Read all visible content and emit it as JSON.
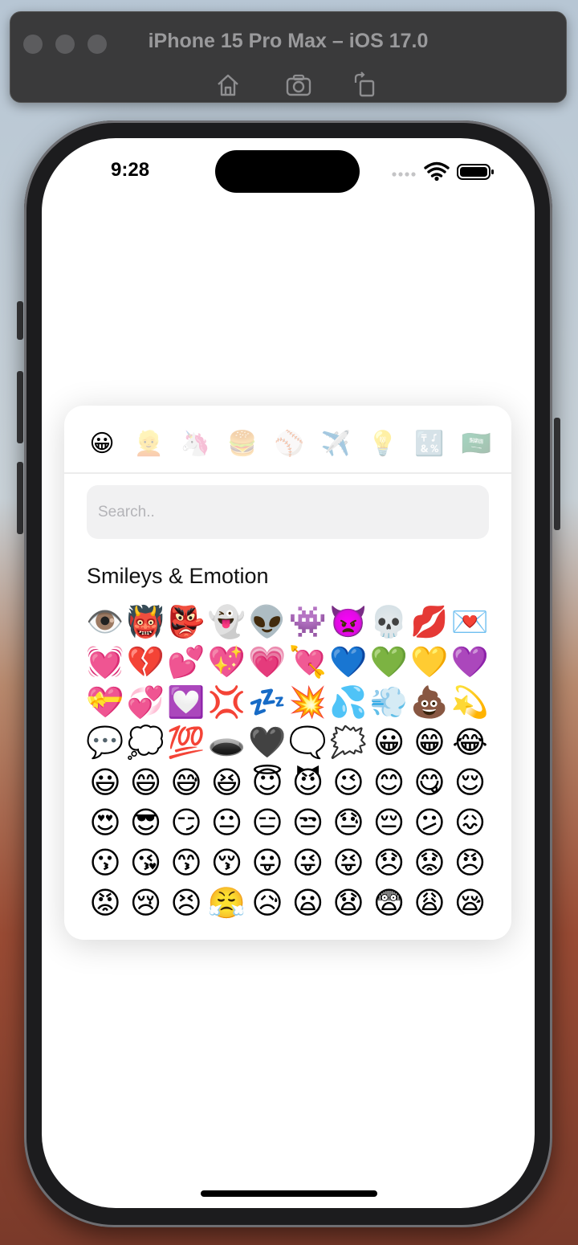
{
  "simulator": {
    "title": "iPhone 15 Pro Max – iOS 17.0",
    "icons": [
      "home-icon",
      "screenshot-icon",
      "rotate-icon"
    ]
  },
  "status_bar": {
    "time": "9:28"
  },
  "categories": [
    {
      "name": "smileys",
      "emoji": "😀",
      "active": true
    },
    {
      "name": "people",
      "emoji": "👱",
      "active": false
    },
    {
      "name": "animals",
      "emoji": "🦄",
      "active": false
    },
    {
      "name": "food",
      "emoji": "🍔",
      "active": false
    },
    {
      "name": "activities",
      "emoji": "⚾",
      "active": false
    },
    {
      "name": "travel",
      "emoji": "✈️",
      "active": false
    },
    {
      "name": "objects",
      "emoji": "💡",
      "active": false
    },
    {
      "name": "symbols",
      "emoji": "🔣",
      "active": false
    },
    {
      "name": "flags",
      "emoji": "🇸🇦",
      "active": false
    }
  ],
  "search": {
    "placeholder": "Search.."
  },
  "section": {
    "title": "Smileys & Emotion"
  },
  "emojis": [
    "👁️",
    "👹",
    "👺",
    "👻",
    "👽",
    "👾",
    "👿",
    "💀",
    "💋",
    "💌",
    "💓",
    "💔",
    "💕",
    "💖",
    "💗",
    "💘",
    "💙",
    "💚",
    "💛",
    "💜",
    "💝",
    "💞",
    "💟",
    "💢",
    "💤",
    "💥",
    "💦",
    "💨",
    "💩",
    "💫",
    "💬",
    "💭",
    "💯",
    "🕳️",
    "🖤",
    "🗨️",
    "🗯️",
    "😀",
    "😁",
    "😂",
    "😃",
    "😄",
    "😅",
    "😆",
    "😇",
    "😈",
    "😉",
    "😊",
    "😋",
    "😌",
    "😍",
    "😎",
    "😏",
    "😐",
    "😑",
    "😒",
    "😓",
    "😔",
    "😕",
    "😖",
    "😗",
    "😘",
    "😙",
    "😚",
    "😛",
    "😜",
    "😝",
    "😞",
    "😟",
    "😠",
    "😡",
    "😢",
    "😣",
    "😤",
    "😥",
    "😦",
    "😧",
    "😨",
    "😩",
    "😪"
  ]
}
